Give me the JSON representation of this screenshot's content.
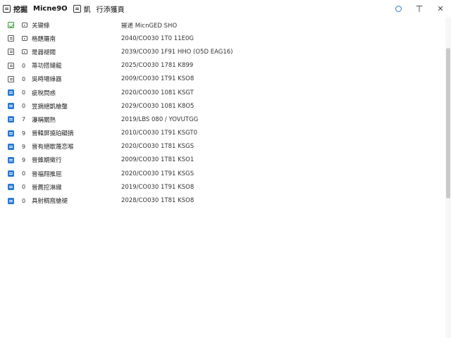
{
  "titlebar": {
    "app_name": "挖掘",
    "title_main": "Micne9O",
    "sep_icon_name": "document-icon",
    "section": "凱",
    "subtitle": "行添獲頁",
    "buttons": {
      "circle": "◯",
      "minimize": "ㄒ",
      "close": "✕"
    }
  },
  "list": {
    "header": {
      "icon": "check-file-icon",
      "type_glyph": "box",
      "name": "关键條",
      "date": "摧递 MicnGED SHO"
    },
    "rows": [
      {
        "icon": "outline-file-icon",
        "type": "box",
        "name": "格題羅南",
        "date": "2040/CO030 1T0 11E0G"
      },
      {
        "icon": "outline-file-icon",
        "type": "box",
        "name": "是器褪閥",
        "date": "2039/CO030 1F91 HHO (O5D EAG16)"
      },
      {
        "icon": "outline-file-icon",
        "type": "0",
        "name": "箒功搭鏈龍",
        "date": "2025/CO030 1781 K899"
      },
      {
        "icon": "outline-file-icon",
        "type": "0",
        "name": "吳時場綠器",
        "date": "2009/CO030 1T91 KSO8"
      },
      {
        "icon": "blue-file-icon",
        "type": "0",
        "name": "疵稅問惑",
        "date": "2020/CO030 1081 KSGT"
      },
      {
        "icon": "blue-file-icon",
        "type": "0",
        "name": "昱摘絕凱槍壟",
        "date": "2029/CO030 1081 K8O5"
      },
      {
        "icon": "blue-file-icon",
        "type": "7",
        "name": "瀑稱關熱",
        "date": "2019/LBS 080 / YOVUTGG"
      },
      {
        "icon": "blue-file-icon",
        "type": "9",
        "name": "晉韓屏撓珀礙摘",
        "date": "2010/CO030 1T91 KSGT0"
      },
      {
        "icon": "blue-file-icon",
        "type": "9",
        "name": "晉有絕歇蔑恋喉",
        "date": "2020/CO030 1T81 KSGS"
      },
      {
        "icon": "blue-file-icon",
        "type": "9",
        "name": "晉錐期徵行",
        "date": "2009/CO030 1T81 KSO1"
      },
      {
        "icon": "blue-file-icon",
        "type": "0",
        "name": "晉福翔推屈",
        "date": "2020/CO030 1T91 KSGS"
      },
      {
        "icon": "blue-file-icon",
        "type": "0",
        "name": "晉薦挖淋織",
        "date": "2019/CO030 1T91 KSO8"
      },
      {
        "icon": "blue-file-icon",
        "type": "0",
        "name": "具射稠窩艙褪",
        "date": "2028/CO030 1T81 KSO8"
      }
    ]
  },
  "colors": {
    "accent": "#2a7ad6",
    "scrollbar": "#c9c9c9"
  }
}
